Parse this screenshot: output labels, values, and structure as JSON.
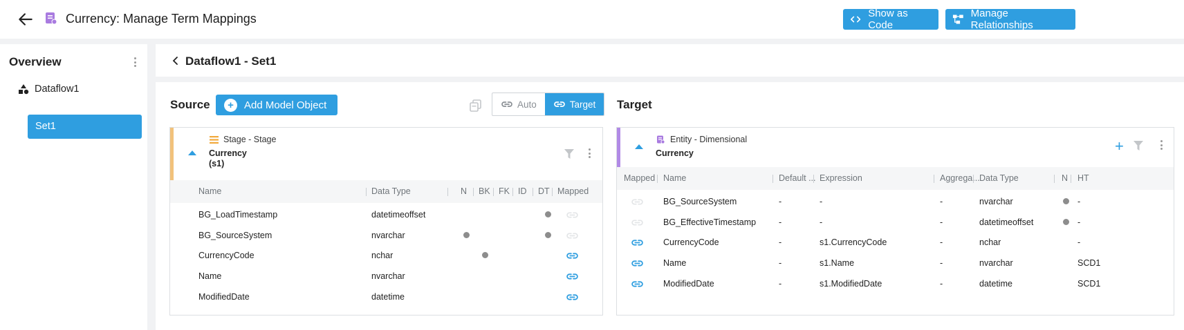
{
  "header": {
    "title": "Currency: Manage Term Mappings",
    "show_code_label": "Show as Code",
    "manage_rel_label": "Manage Relationships"
  },
  "sidebar": {
    "title": "Overview",
    "tree_root": "Dataflow1",
    "selected_item": "Set1"
  },
  "breadcrumb": {
    "text": "Dataflow1 - Set1"
  },
  "source": {
    "title": "Source",
    "add_button": "Add Model Object",
    "toggle_auto": "Auto",
    "toggle_target": "Target",
    "card": {
      "type_label": "Stage - Stage",
      "name": "Currency",
      "alias": "(s1)",
      "columns": [
        "Name",
        "Data Type",
        "N",
        "BK",
        "FK",
        "ID",
        "DT",
        "Mapped"
      ],
      "rows": [
        {
          "name": "BG_LoadTimestamp",
          "type": "datetimeoffset",
          "N": false,
          "BK": false,
          "DT": true,
          "mapped": false
        },
        {
          "name": "BG_SourceSystem",
          "type": "nvarchar",
          "N": true,
          "BK": false,
          "DT": true,
          "mapped": false
        },
        {
          "name": "CurrencyCode",
          "type": "nchar",
          "N": false,
          "BK": true,
          "DT": false,
          "mapped": true
        },
        {
          "name": "Name",
          "type": "nvarchar",
          "N": false,
          "BK": false,
          "DT": false,
          "mapped": true
        },
        {
          "name": "ModifiedDate",
          "type": "datetime",
          "N": false,
          "BK": false,
          "DT": false,
          "mapped": true
        }
      ]
    }
  },
  "target": {
    "title": "Target",
    "card": {
      "type_label": "Entity - Dimensional",
      "name": "Currency",
      "columns": [
        "Mapped",
        "Name",
        "Default ...",
        "Expression",
        "Aggrega...",
        "Data Type",
        "N",
        "HT"
      ],
      "rows": [
        {
          "mapped": false,
          "name": "BG_SourceSystem",
          "default": "-",
          "expression": "-",
          "aggregate": "-",
          "type": "nvarchar",
          "N": true,
          "ht": "-"
        },
        {
          "mapped": false,
          "name": "BG_EffectiveTimestamp",
          "default": "-",
          "expression": "-",
          "aggregate": "-",
          "type": "datetimeoffset",
          "N": true,
          "ht": "-"
        },
        {
          "mapped": true,
          "name": "CurrencyCode",
          "default": "-",
          "expression": "s1.CurrencyCode",
          "aggregate": "-",
          "type": "nchar",
          "N": false,
          "ht": "-"
        },
        {
          "mapped": true,
          "name": "Name",
          "default": "-",
          "expression": "s1.Name",
          "aggregate": "-",
          "type": "nvarchar",
          "N": false,
          "ht": "SCD1"
        },
        {
          "mapped": true,
          "name": "ModifiedDate",
          "default": "-",
          "expression": "s1.ModifiedDate",
          "aggregate": "-",
          "type": "datetime",
          "N": false,
          "ht": "SCD1"
        }
      ]
    }
  },
  "colors": {
    "accent": "#2f9ee0",
    "stage_stripe": "#f2c27b",
    "entity_stripe": "#b18ae6",
    "icon_purple": "#a97be0"
  },
  "icons": {
    "back": "arrow-left-icon",
    "title": "entity-icon",
    "code": "code-icon",
    "relationships": "relationships-icon",
    "tree": "shapes-icon",
    "copy": "copy-icon",
    "link": "link-icon",
    "filter": "filter-icon",
    "stage": "stage-icon"
  }
}
